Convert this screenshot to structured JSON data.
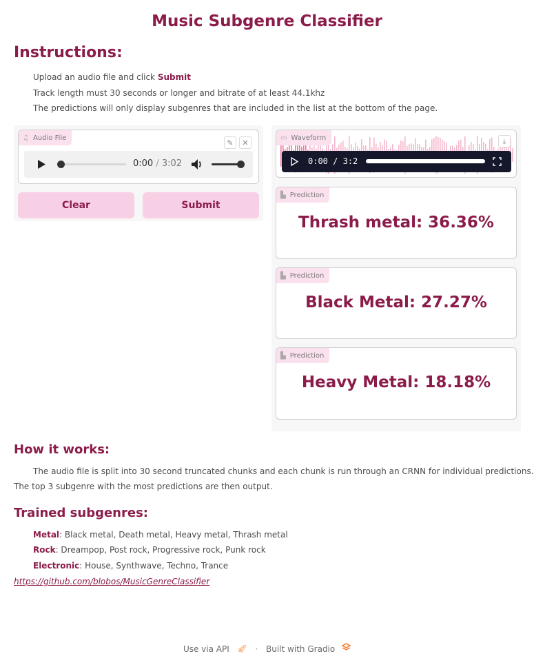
{
  "title": "Music Subgenre Classifier",
  "instructions": {
    "heading": "Instructions:",
    "line1_prefix": "Upload an audio file and click ",
    "line1_bold": "Submit",
    "line2": "Track length must 30 seconds or longer and bitrate of at least 44.1khz",
    "line3": "The predictions will only display subgenres that are included in the list at the bottom of the page."
  },
  "audio_input": {
    "label": "Audio File",
    "time_current": "0:00",
    "time_separator": "/",
    "time_total": "3:02"
  },
  "buttons": {
    "clear": "Clear",
    "submit": "Submit"
  },
  "waveform": {
    "label": "Waveform",
    "time_current": "0:00",
    "time_separator": "/",
    "time_total": "3:2"
  },
  "predictions": [
    {
      "label": "Prediction",
      "value": "Thrash metal: 36.36%"
    },
    {
      "label": "Prediction",
      "value": "Black Metal: 27.27%"
    },
    {
      "label": "Prediction",
      "value": "Heavy Metal: 18.18%"
    }
  ],
  "how_it_works": {
    "heading": "How it works:",
    "line1": "The audio file is split into 30 second truncated chunks and each chunk is run through an CRNN for individual predictions.",
    "line2": "The top 3 subgenre with the most predictions are then output."
  },
  "trained": {
    "heading": "Trained subgenres:",
    "genres": [
      {
        "name": "Metal",
        "list": ": Black metal, Death metal, Heavy metal, Thrash metal"
      },
      {
        "name": "Rock",
        "list": ": Dreampop, Post rock, Progressive rock, Punk rock"
      },
      {
        "name": "Electronic",
        "list": ": House, Synthwave, Techno, Trance"
      }
    ],
    "link": "https://github.com/blobos/MusicGenreClassifier"
  },
  "footer": {
    "api": "Use via API",
    "dot": "·",
    "built": "Built with Gradio"
  },
  "colors": {
    "accent": "#8b1c4a",
    "button_bg": "#f8d0e6",
    "tag_bg": "#fbe0ee"
  }
}
